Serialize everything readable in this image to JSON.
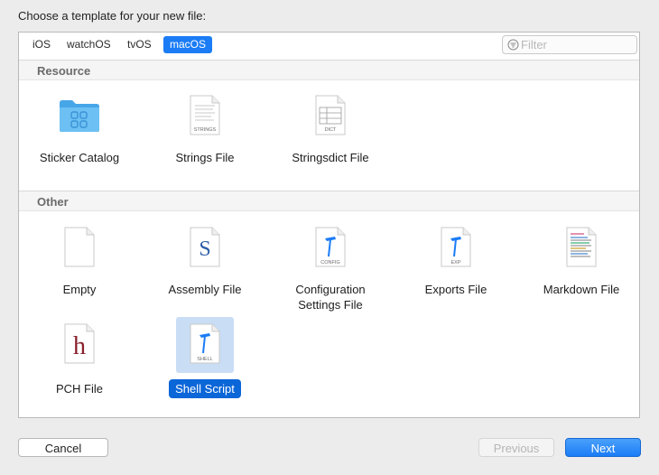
{
  "dialog": {
    "title": "Choose a template for your new file:"
  },
  "platform_tabs": [
    {
      "label": "iOS",
      "selected": false
    },
    {
      "label": "watchOS",
      "selected": false
    },
    {
      "label": "tvOS",
      "selected": false
    },
    {
      "label": "macOS",
      "selected": true
    }
  ],
  "filter": {
    "placeholder": "Filter",
    "value": ""
  },
  "sections": [
    {
      "title": "Resource",
      "items": [
        {
          "label": "Sticker Catalog",
          "icon": "folder-icon",
          "badge": ""
        },
        {
          "label": "Strings File",
          "icon": "strings-file-icon",
          "badge": "STRINGS"
        },
        {
          "label": "Stringsdict File",
          "icon": "stringsdict-file-icon",
          "badge": "DICT"
        }
      ]
    },
    {
      "title": "Other",
      "items": [
        {
          "label": "Empty",
          "icon": "empty-file-icon",
          "badge": ""
        },
        {
          "label": "Assembly File",
          "icon": "assembly-file-icon",
          "badge": "",
          "glyph": "S"
        },
        {
          "label": "Configuration Settings File",
          "label_line1": "Configuration",
          "label_line2": "Settings File",
          "icon": "config-file-icon",
          "badge": "CONFIG"
        },
        {
          "label": "Exports File",
          "icon": "exports-file-icon",
          "badge": "EXP"
        },
        {
          "label": "Markdown File",
          "icon": "markdown-file-icon",
          "badge": ""
        },
        {
          "label": "PCH File",
          "icon": "pch-file-icon",
          "badge": "",
          "glyph": "h"
        },
        {
          "label": "Shell Script",
          "icon": "shell-script-icon",
          "badge": "SHELL",
          "selected": true
        }
      ]
    }
  ],
  "buttons": {
    "cancel": "Cancel",
    "previous": "Previous",
    "next": "Next"
  },
  "colors": {
    "accent": "#1b7cf6",
    "selection": "#0b66d8",
    "folder": "#5ab4ef",
    "pch_glyph": "#8a1f2c",
    "assembly_glyph": "#2d5fa8"
  }
}
